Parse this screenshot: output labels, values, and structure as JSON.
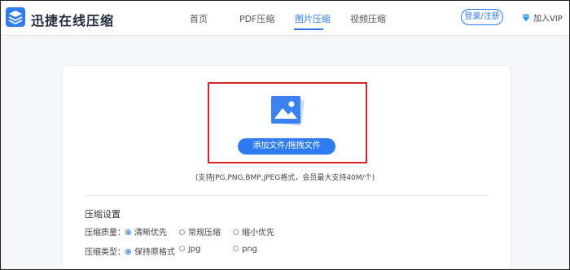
{
  "header": {
    "brand": "迅捷在线压缩",
    "nav": [
      {
        "label": "首页"
      },
      {
        "label": "PDF压缩"
      },
      {
        "label": "图片压缩"
      },
      {
        "label": "视频压缩"
      }
    ],
    "login_label": "登录/注册",
    "vip_label": "加入VIP"
  },
  "upload": {
    "button_label": "添加文件/拖拽文件",
    "support_text": "(支持JPG,PNG,BMP,JPEG格式，会员最大支持40M/个)"
  },
  "settings": {
    "title": "压缩设置",
    "quality": {
      "label": "压缩质量：",
      "options": [
        "清晰优先",
        "常规压缩",
        "缩小优先"
      ],
      "selected": "清晰优先"
    },
    "type": {
      "label": "压缩类型：",
      "options": [
        "保持原格式",
        "jpg",
        "png"
      ],
      "selected": "保持原格式"
    }
  },
  "colors": {
    "accent": "#2f7bf0",
    "highlight_border": "#d8232a"
  }
}
